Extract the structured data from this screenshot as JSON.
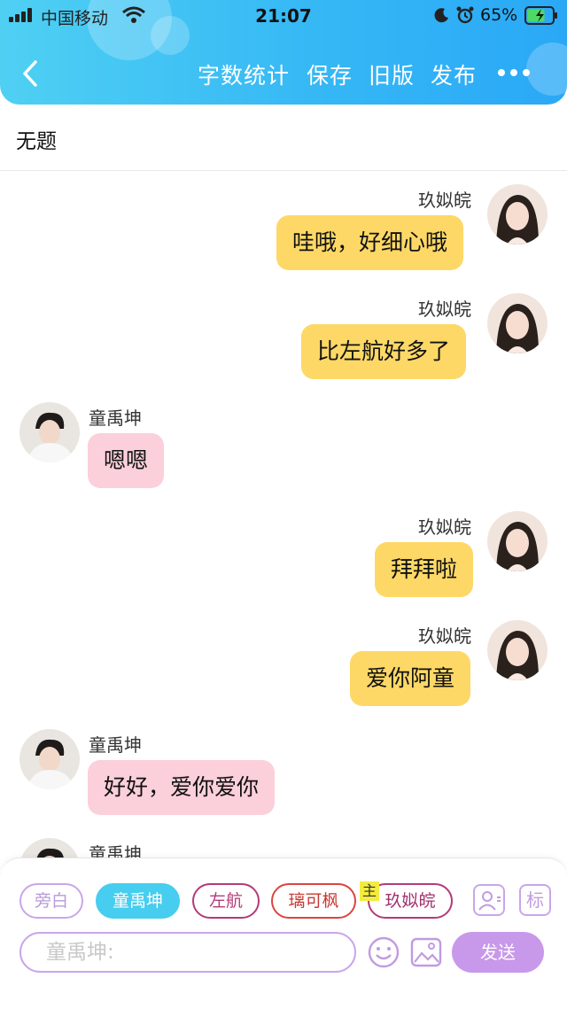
{
  "status_bar": {
    "carrier": "中国移动",
    "time": "21:07",
    "battery": "65%",
    "icons": [
      "signal-icon",
      "wifi-icon",
      "moon-icon",
      "alarm-icon",
      "battery-icon"
    ]
  },
  "header": {
    "back_icon": "chevron-left-icon",
    "actions": [
      "字数统计",
      "保存",
      "旧版",
      "发布"
    ],
    "more_icon": "more-dots-icon",
    "colors": {
      "gradient_start": "#4fd0f3",
      "gradient_end": "#2aa8f6"
    }
  },
  "document": {
    "title": "无题"
  },
  "messages": [
    {
      "side": "right",
      "name": "玖姒皖",
      "text": "哇哦，好细心哦"
    },
    {
      "side": "right",
      "name": "玖姒皖",
      "text": "比左航好多了"
    },
    {
      "side": "left",
      "name": "童禹坤",
      "text": "嗯嗯"
    },
    {
      "side": "right",
      "name": "玖姒皖",
      "text": "拜拜啦"
    },
    {
      "side": "right",
      "name": "玖姒皖",
      "text": "爱你阿童"
    },
    {
      "side": "left",
      "name": "童禹坤",
      "text": "好好，爱你爱你"
    },
    {
      "side": "left",
      "name": "童禹坤",
      "text": ""
    }
  ],
  "composer": {
    "roles": [
      "旁白",
      "童禹坤",
      "左航",
      "璃可枫",
      "玖姒皖"
    ],
    "selected_role": "童禹坤",
    "main_badge": "主",
    "label_button": "标",
    "placeholder": "童禹坤:",
    "send_label": "发送",
    "colors": {
      "active_role": "#46cdef",
      "send": "#c898ea",
      "right_bubble": "#fdd866",
      "left_bubble": "#fbd0da"
    }
  }
}
